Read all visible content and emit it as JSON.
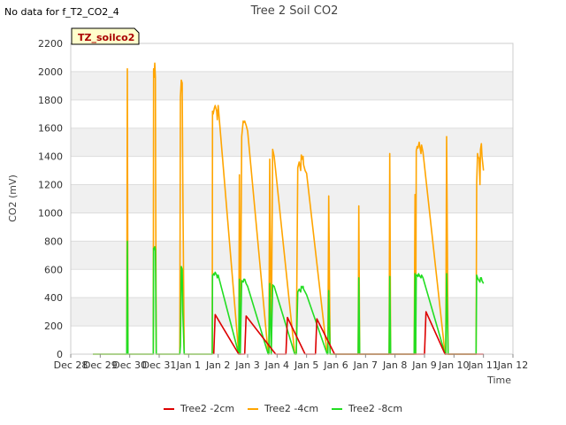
{
  "header": {
    "no_data_text": "No data for f_T2_CO2_4"
  },
  "chart_data": {
    "type": "line",
    "title": "Tree 2 Soil CO2",
    "xlabel": "Time",
    "ylabel": "CO2 (mV)",
    "ylim": [
      0,
      2200
    ],
    "yticks": [
      0,
      200,
      400,
      600,
      800,
      1000,
      1200,
      1400,
      1600,
      1800,
      2000,
      2200
    ],
    "xlim": [
      0,
      15
    ],
    "xtick_labels": [
      "Dec 28",
      "Dec 29",
      "Dec 30",
      "Dec 31",
      "Jan 1",
      "Jan 2",
      "Jan 3",
      "Jan 4",
      "Jan 5",
      "Jan 6",
      "Jan 7",
      "Jan 8",
      "Jan 9",
      "Jan 10",
      "Jan 11",
      "Jan 12"
    ],
    "x_units": "days since Dec 28",
    "tag_label": "TZ_soilco2",
    "legend_position": "bottom",
    "grid": true,
    "background_bands": true,
    "series": [
      {
        "name": "Tree2 -2cm",
        "color": "#dd0000",
        "x": [
          4.85,
          4.9,
          5.7,
          5.75,
          5.9,
          5.95,
          6.95,
          7.0,
          7.3,
          7.35,
          7.95,
          8.0,
          8.3,
          8.35,
          8.95,
          9.0,
          11.9,
          12.0,
          12.05,
          12.7,
          12.75,
          13.95,
          14.0
        ],
        "y": [
          0,
          280,
          0,
          0,
          0,
          270,
          0,
          0,
          0,
          260,
          0,
          0,
          0,
          250,
          0,
          0,
          0,
          0,
          300,
          0,
          0,
          0,
          0
        ]
      },
      {
        "name": "Tree2 -4cm",
        "color": "#ffa500",
        "x": [
          0.75,
          1.0,
          1.9,
          1.92,
          1.94,
          2.0,
          2.8,
          2.81,
          2.83,
          2.85,
          2.87,
          2.88,
          2.9,
          2.95,
          3.7,
          3.72,
          3.75,
          3.78,
          3.8,
          3.85,
          4.8,
          4.81,
          4.83,
          4.85,
          4.87,
          4.9,
          4.95,
          4.97,
          5.0,
          5.7,
          5.72,
          5.75,
          5.8,
          5.85,
          5.87,
          5.9,
          5.95,
          6.0,
          6.7,
          6.72,
          6.75,
          6.8,
          6.85,
          6.9,
          7.6,
          7.65,
          7.7,
          7.75,
          7.8,
          7.82,
          7.85,
          7.88,
          7.9,
          7.95,
          8.0,
          8.7,
          8.72,
          8.75,
          8.8,
          9.75,
          9.77,
          9.8,
          10.8,
          10.82,
          10.85,
          11.65,
          11.68,
          11.7,
          11.72,
          11.75,
          11.78,
          11.8,
          11.82,
          11.85,
          11.88,
          11.9,
          11.95,
          12.7,
          12.72,
          12.75,
          12.8,
          13.75,
          13.77,
          13.8,
          13.82,
          13.85,
          13.88,
          13.9,
          13.93,
          13.95,
          14.0
        ],
        "y": [
          0,
          0,
          0,
          2020,
          0,
          0,
          0,
          2020,
          1960,
          2060,
          1960,
          1200,
          0,
          0,
          0,
          1820,
          1940,
          1920,
          1200,
          0,
          0,
          1720,
          1700,
          1720,
          1740,
          1760,
          1720,
          1660,
          1760,
          0,
          1270,
          0,
          1540,
          1650,
          1640,
          1650,
          1620,
          1580,
          0,
          0,
          1380,
          0,
          1450,
          1400,
          0,
          0,
          1320,
          1360,
          1300,
          1410,
          1380,
          1400,
          1340,
          1300,
          1280,
          0,
          0,
          1120,
          0,
          0,
          1050,
          0,
          0,
          1420,
          0,
          0,
          1130,
          0,
          1440,
          1470,
          1460,
          1480,
          1500,
          1460,
          1420,
          1480,
          1430,
          0,
          0,
          1540,
          0,
          0,
          1210,
          1420,
          1390,
          1390,
          1200,
          1450,
          1490,
          1400,
          1300
        ]
      },
      {
        "name": "Tree2 -8cm",
        "color": "#22dd22",
        "x": [
          0.75,
          1.0,
          1.9,
          1.92,
          1.94,
          2.0,
          2.8,
          2.81,
          2.83,
          2.85,
          2.87,
          2.88,
          2.9,
          2.95,
          3.7,
          3.72,
          3.75,
          3.78,
          3.8,
          3.85,
          4.8,
          4.81,
          4.83,
          4.85,
          4.87,
          4.9,
          4.95,
          4.97,
          5.0,
          5.7,
          5.72,
          5.75,
          5.8,
          5.85,
          5.87,
          5.9,
          5.95,
          6.0,
          6.7,
          6.72,
          6.75,
          6.8,
          6.85,
          6.9,
          7.6,
          7.65,
          7.7,
          7.75,
          7.8,
          7.82,
          7.85,
          7.88,
          7.9,
          7.95,
          8.0,
          8.7,
          8.72,
          8.75,
          8.8,
          9.75,
          9.77,
          9.8,
          10.8,
          10.82,
          10.85,
          11.65,
          11.68,
          11.7,
          11.72,
          11.75,
          11.78,
          11.8,
          11.82,
          11.85,
          11.88,
          11.9,
          11.95,
          12.7,
          12.72,
          12.75,
          12.8,
          13.75,
          13.77,
          13.8,
          13.82,
          13.85,
          13.88,
          13.9,
          13.93,
          13.95,
          14.0
        ],
        "y": [
          0,
          0,
          0,
          800,
          0,
          0,
          0,
          750,
          740,
          760,
          740,
          560,
          0,
          0,
          0,
          60,
          620,
          600,
          300,
          0,
          0,
          560,
          560,
          570,
          560,
          580,
          560,
          540,
          560,
          0,
          530,
          0,
          520,
          510,
          530,
          530,
          500,
          480,
          0,
          0,
          500,
          0,
          490,
          480,
          0,
          0,
          440,
          460,
          440,
          480,
          470,
          480,
          460,
          440,
          420,
          0,
          0,
          450,
          0,
          0,
          540,
          0,
          0,
          550,
          0,
          0,
          570,
          0,
          560,
          560,
          550,
          570,
          560,
          550,
          540,
          560,
          540,
          0,
          0,
          570,
          0,
          0,
          560,
          540,
          530,
          520,
          510,
          540,
          540,
          520,
          500
        ]
      }
    ]
  }
}
